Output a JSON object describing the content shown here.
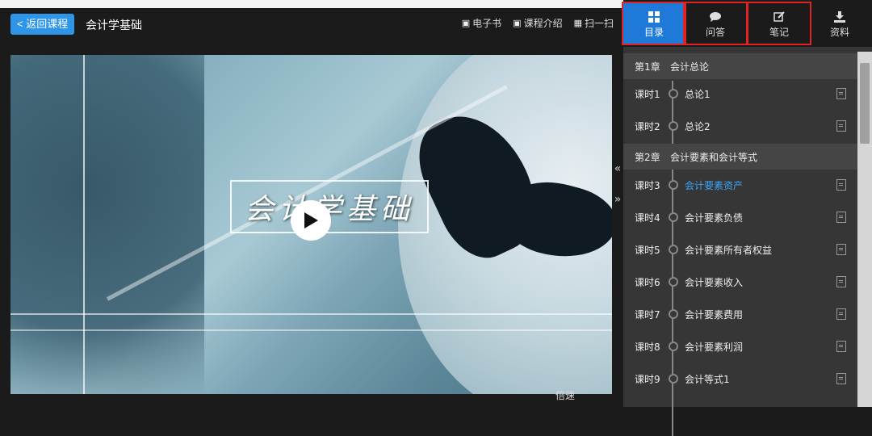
{
  "header": {
    "back_label": "< 返回课程",
    "course_title": "会计学基础",
    "links": [
      {
        "label": "电子书",
        "icon": "book-icon"
      },
      {
        "label": "课程介绍",
        "icon": "info-book-icon"
      },
      {
        "label": "扫一扫",
        "icon": "qr-icon"
      }
    ]
  },
  "video": {
    "title_text": "会计学基础",
    "speed_label": "倍速"
  },
  "sidebar": {
    "collapse_arrows": [
      "«",
      "»"
    ],
    "tabs": [
      {
        "label": "目录",
        "icon": "grid-icon",
        "active": true
      },
      {
        "label": "问答",
        "icon": "chat-icon",
        "active": false
      },
      {
        "label": "笔记",
        "icon": "edit-icon",
        "active": false
      },
      {
        "label": "资料",
        "icon": "download-icon",
        "active": false
      }
    ],
    "chapters": [
      {
        "no": "第1章",
        "title": "会计总论"
      },
      {
        "no": "第2章",
        "title": "会计要素和会计等式"
      }
    ],
    "lessons": [
      {
        "no": "课时1",
        "title": "总论1"
      },
      {
        "no": "课时2",
        "title": "总论2"
      },
      {
        "no": "课时3",
        "title": "会计要素资产"
      },
      {
        "no": "课时4",
        "title": "会计要素负债"
      },
      {
        "no": "课时5",
        "title": "会计要素所有者权益"
      },
      {
        "no": "课时6",
        "title": "会计要素收入"
      },
      {
        "no": "课时7",
        "title": "会计要素费用"
      },
      {
        "no": "课时8",
        "title": "会计要素利润"
      },
      {
        "no": "课时9",
        "title": "会计等式1"
      }
    ],
    "active_lesson": "课时3"
  },
  "colors": {
    "accent": "#1e79d9",
    "active_text": "#3aa5f5",
    "highlight_border": "#e02424"
  }
}
